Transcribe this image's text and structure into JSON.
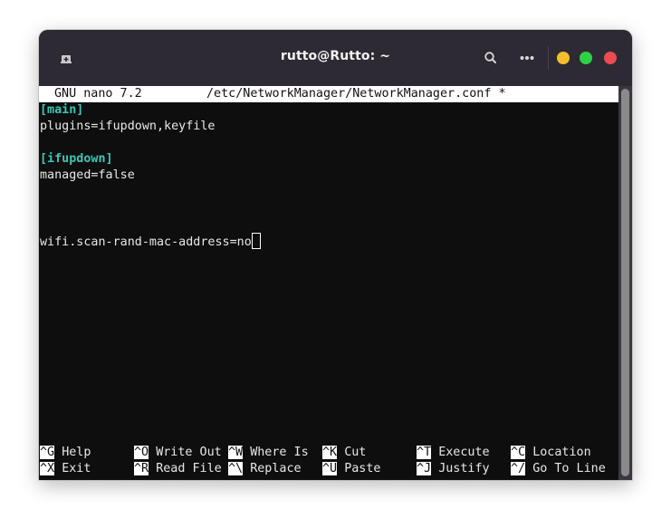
{
  "window": {
    "title": "rutto@Rutto: ~",
    "icons": {
      "new_tab": "new-tab-icon",
      "search": "search-icon",
      "menu": "more-horizontal-icon"
    },
    "controls": {
      "minimize_color": "#f6be2c",
      "maximize_color": "#2ed146",
      "close_color": "#ec4b55"
    }
  },
  "nano": {
    "version": "GNU nano 7.2",
    "filename": "/etc/NetworkManager/NetworkManager.conf *",
    "lines": [
      {
        "text": "[main]",
        "type": "section"
      },
      {
        "text": "plugins=ifupdown,keyfile",
        "type": "text"
      },
      {
        "text": "",
        "type": "text"
      },
      {
        "text": "[ifupdown]",
        "type": "section"
      },
      {
        "text": "managed=false",
        "type": "text"
      },
      {
        "text": "",
        "type": "text"
      },
      {
        "text": "",
        "type": "text"
      },
      {
        "text": "",
        "type": "text"
      },
      {
        "text": "wifi.scan-rand-mac-address=no",
        "type": "text"
      }
    ],
    "section_color": "#3fc5b2",
    "shortcuts": [
      {
        "key": "^G",
        "label": "Help"
      },
      {
        "key": "^X",
        "label": "Exit"
      },
      {
        "key": "^O",
        "label": "Write Out"
      },
      {
        "key": "^R",
        "label": "Read File"
      },
      {
        "key": "^W",
        "label": "Where Is"
      },
      {
        "key": "^\\",
        "label": "Replace"
      },
      {
        "key": "^K",
        "label": "Cut"
      },
      {
        "key": "^U",
        "label": "Paste"
      },
      {
        "key": "^T",
        "label": "Execute"
      },
      {
        "key": "^J",
        "label": "Justify"
      },
      {
        "key": "^C",
        "label": "Location"
      },
      {
        "key": "^/",
        "label": "Go To Line"
      }
    ]
  }
}
